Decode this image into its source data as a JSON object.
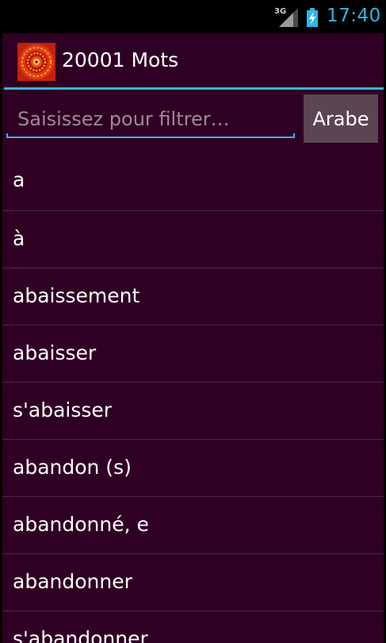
{
  "status_bar": {
    "network_type": "3G",
    "time": "17:40",
    "clock_color": "#33b5e5"
  },
  "action_bar": {
    "title": "20001 Mots",
    "icon": "mandala-app-icon"
  },
  "filter": {
    "placeholder": "Saisissez pour filtrer…",
    "value": ""
  },
  "language_button": {
    "label": "Arabe"
  },
  "colors": {
    "background": "#300024",
    "accent": "#33b5e5",
    "button": "#5b4552",
    "divider": "#4a2a3f"
  },
  "words": [
    "a",
    "à",
    "abaissement",
    "abaisser",
    "s'abaisser",
    "abandon (s)",
    "abandonné, e",
    "abandonner",
    "s'abandonner"
  ]
}
